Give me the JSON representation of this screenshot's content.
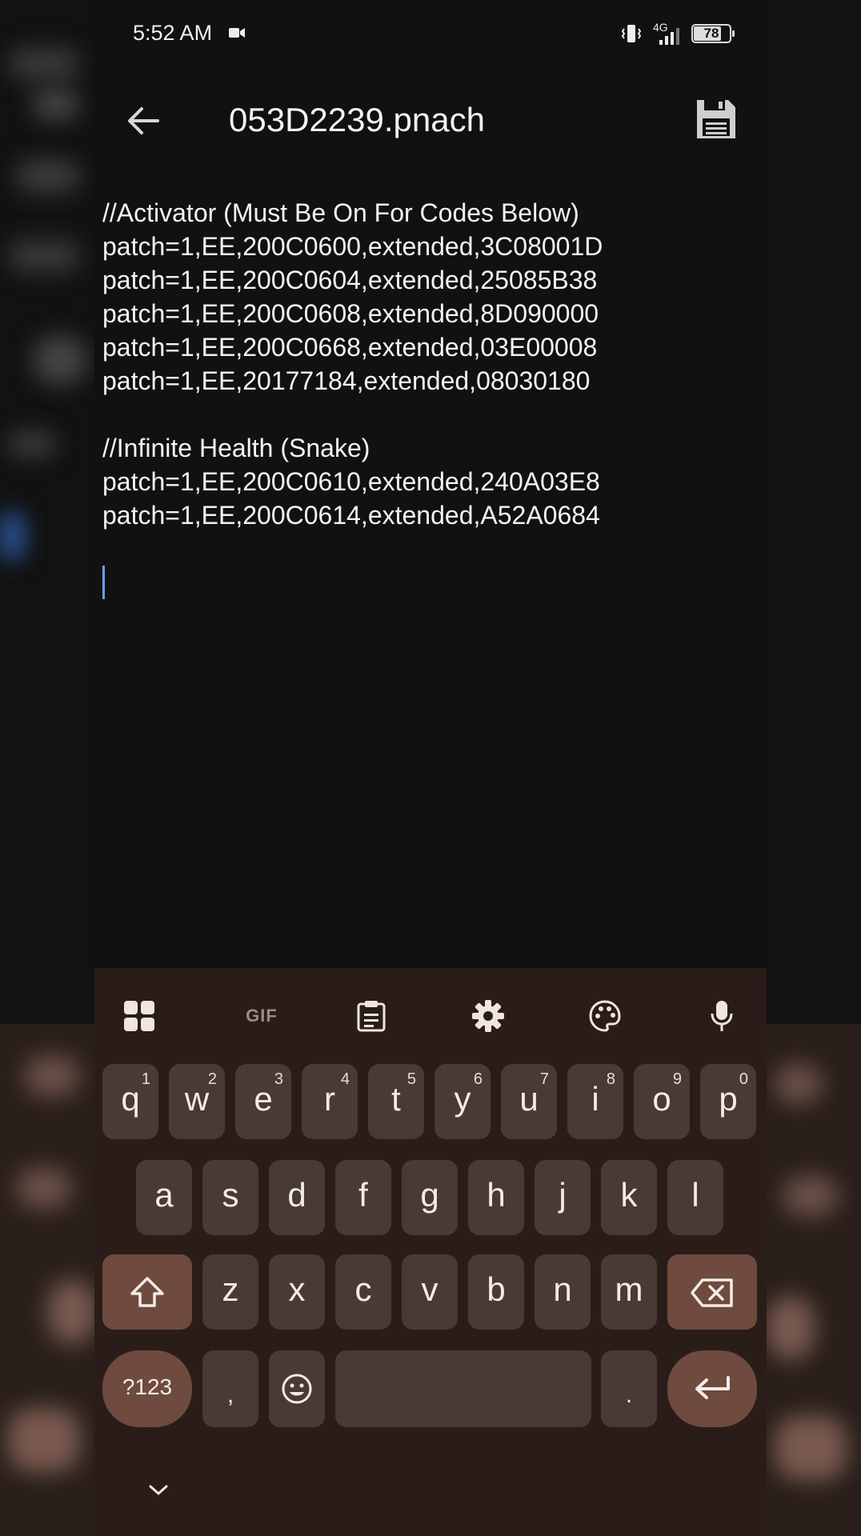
{
  "status_bar": {
    "time": "5:52 AM",
    "network": "4G",
    "battery": "78"
  },
  "app_bar": {
    "title": "053D2239.pnach"
  },
  "editor": {
    "lines": [
      "//Activator (Must Be On For Codes Below)",
      "patch=1,EE,200C0600,extended,3C08001D",
      "patch=1,EE,200C0604,extended,25085B38",
      "patch=1,EE,200C0608,extended,8D090000",
      "patch=1,EE,200C0668,extended,03E00008",
      "patch=1,EE,20177184,extended,08030180",
      "",
      "//Infinite Health (Snake)",
      "patch=1,EE,200C0610,extended,240A03E8",
      "patch=1,EE,200C0614,extended,A52A0684"
    ]
  },
  "keyboard": {
    "toolbar": {
      "gif_label": "GIF"
    },
    "row1": [
      {
        "ch": "q",
        "hint": "1"
      },
      {
        "ch": "w",
        "hint": "2"
      },
      {
        "ch": "e",
        "hint": "3"
      },
      {
        "ch": "r",
        "hint": "4"
      },
      {
        "ch": "t",
        "hint": "5"
      },
      {
        "ch": "y",
        "hint": "6"
      },
      {
        "ch": "u",
        "hint": "7"
      },
      {
        "ch": "i",
        "hint": "8"
      },
      {
        "ch": "o",
        "hint": "9"
      },
      {
        "ch": "p",
        "hint": "0"
      }
    ],
    "row2": [
      "a",
      "s",
      "d",
      "f",
      "g",
      "h",
      "j",
      "k",
      "l"
    ],
    "row3": [
      "z",
      "x",
      "c",
      "v",
      "b",
      "n",
      "m"
    ],
    "symbols_label": "?123",
    "comma": ",",
    "period": "."
  },
  "colors": {
    "background": "#111111",
    "keyboard_bg": "#2a1d19",
    "key_bg": "#4a3a34",
    "key_accent": "#6e4a3f",
    "cursor": "#6c9cff"
  }
}
